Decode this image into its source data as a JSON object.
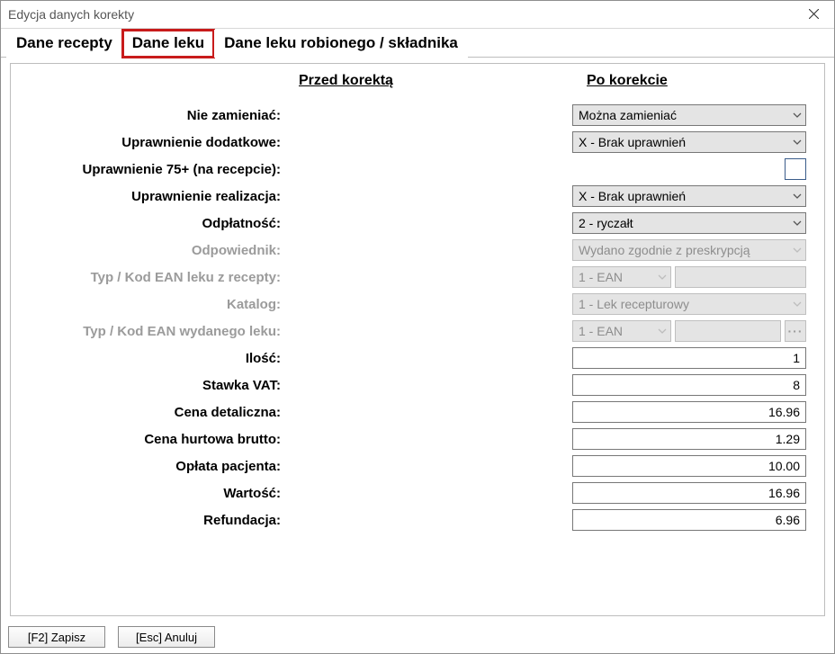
{
  "window": {
    "title": "Edycja danych korekty"
  },
  "tabs": {
    "recepty": "Dane recepty",
    "leku": "Dane leku",
    "robionego": "Dane leku robionego / składnika"
  },
  "columns": {
    "before": "Przed korektą",
    "after": "Po korekcie"
  },
  "labels": {
    "nie_zamieniac": "Nie zamieniać:",
    "uprawnienie_dodatkowe": "Uprawnienie dodatkowe:",
    "uprawnienie_75": "Uprawnienie 75+ (na recepcie):",
    "uprawnienie_realizacja": "Uprawnienie realizacja:",
    "odplatnosc": "Odpłatność:",
    "odpowiednik": "Odpowiednik:",
    "typ_ean_recepty": "Typ / Kod EAN leku z recepty:",
    "katalog": "Katalog:",
    "typ_ean_wydanego": "Typ / Kod EAN wydanego leku:",
    "ilosc": "Ilość:",
    "stawka_vat": "Stawka VAT:",
    "cena_detaliczna": "Cena detaliczna:",
    "cena_hurtowa": "Cena hurtowa brutto:",
    "oplata_pacjenta": "Opłata pacjenta:",
    "wartosc": "Wartość:",
    "refundacja": "Refundacja:"
  },
  "values": {
    "nie_zamieniac": "Można zamieniać",
    "uprawnienie_dodatkowe": "X - Brak uprawnień",
    "uprawnienie_realizacja": "X - Brak uprawnień",
    "odplatnosc": "2 - ryczałt",
    "odpowiednik": "Wydano zgodnie z preskrypcją",
    "typ_ean_recepty": "1 - EAN",
    "katalog": "1 - Lek recepturowy",
    "typ_ean_wydanego": "1 - EAN",
    "ilosc": "1",
    "stawka_vat": "8",
    "cena_detaliczna": "16.96",
    "cena_hurtowa": "1.29",
    "oplata_pacjenta": "10.00",
    "wartosc": "16.96",
    "refundacja": "6.96"
  },
  "footer": {
    "save": "[F2] Zapisz",
    "cancel": "[Esc] Anuluj"
  }
}
